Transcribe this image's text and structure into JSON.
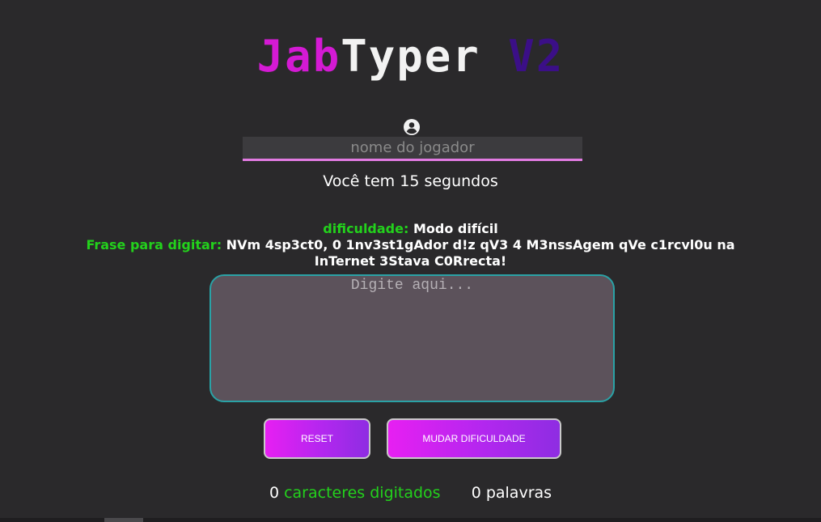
{
  "header": {
    "title_part1": "Jab",
    "title_part2": "Typer",
    "title_part3": "V2"
  },
  "player": {
    "icon": "user-circle-icon",
    "name_placeholder": "nome do jogador",
    "name_value": ""
  },
  "timer": {
    "text": "Você tem 15 segundos"
  },
  "difficulty": {
    "label": "dificuldade:",
    "value": "Modo difícil"
  },
  "phrase": {
    "label": "Frase para digitar:",
    "text": "NVm 4sp3ct0, 0 1nv3st1gAdor d!z qV3 4 M3nssAgem qVe c1rcvl0u na InTernet 3Stava C0Rrecta!"
  },
  "input_area": {
    "placeholder": "Digite aqui...",
    "value": ""
  },
  "buttons": {
    "reset_label": "RESET",
    "change_difficulty_label": "MUDAR DIFICULDADE"
  },
  "stats": {
    "chars_count": "0",
    "chars_label": "caracteres digitados",
    "words_count": "0",
    "words_label": "palavras"
  },
  "colors": {
    "background": "#2a292b",
    "title_pink": "#d41ad4",
    "title_white": "#f2f2f2",
    "title_purple": "#3b0f87",
    "accent_green": "#23d11c",
    "input_underline": "#e27be2",
    "textarea_border": "#2aa2a6",
    "button_gradient_start": "#e71ff2",
    "button_gradient_end": "#8e2de2"
  }
}
